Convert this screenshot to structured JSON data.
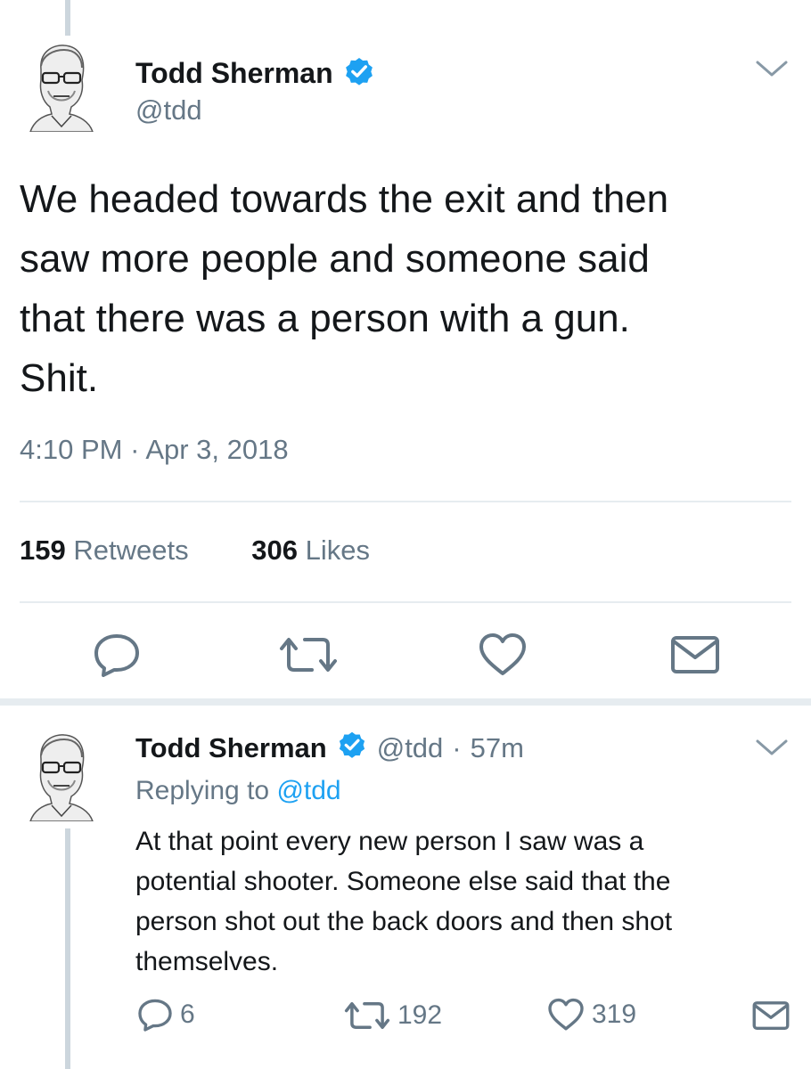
{
  "main_tweet": {
    "display_name": "Todd Sherman",
    "handle": "@tdd",
    "text_lines": [
      "We headed towards the exit and then",
      "saw more people and someone said",
      "that there was a person with a gun.",
      "Shit."
    ],
    "time": "4:10 PM",
    "dot": "·",
    "date": "Apr 3, 2018",
    "retweets_count": "159",
    "retweets_label": "Retweets",
    "likes_count": "306",
    "likes_label": "Likes"
  },
  "reply_tweet": {
    "display_name": "Todd Sherman",
    "handle": "@tdd",
    "dot": "·",
    "age": "57m",
    "replying_prefix": "Replying to",
    "replying_handle": "@tdd",
    "text_lines": [
      "At that point every new person I saw was a",
      "potential shooter. Someone else said that the",
      "person shot out the back doors and then shot",
      "themselves."
    ],
    "reply_count": "6",
    "retweet_count": "192",
    "like_count": "319"
  },
  "icons": {
    "verified": "verified-badge-icon",
    "caret": "chevron-down-icon",
    "reply": "reply-icon",
    "retweet": "retweet-icon",
    "like": "heart-icon",
    "dm": "envelope-icon"
  },
  "colors": {
    "blue": "#1da1f2",
    "gray": "#657786",
    "divider": "#e6ecf0"
  }
}
